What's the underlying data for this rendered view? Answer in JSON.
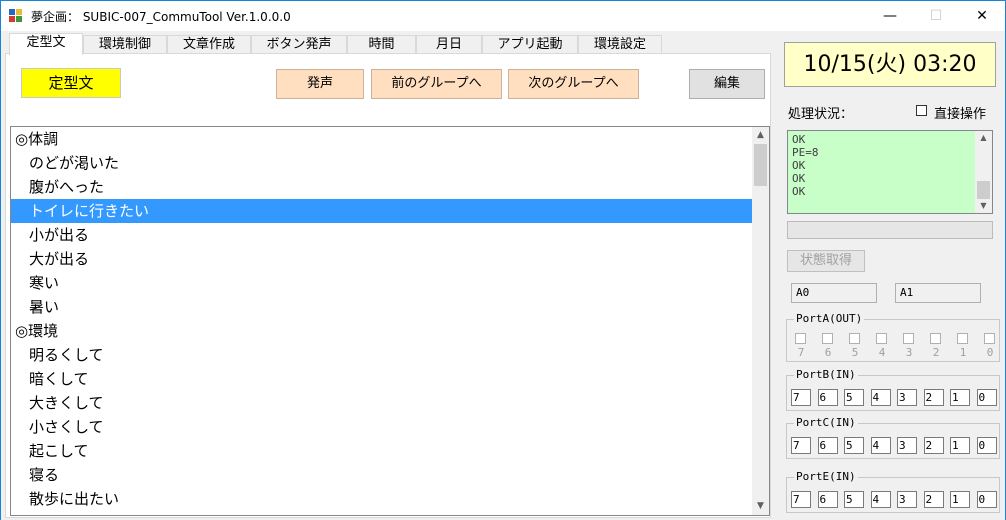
{
  "window": {
    "title": "夢企画： SUBIC-007_CommuTool Ver.1.0.0.0",
    "minimize": "—",
    "maximize": "☐",
    "close": "✕"
  },
  "tabs": [
    {
      "label": "定型文",
      "active": true
    },
    {
      "label": "環境制御",
      "active": false
    },
    {
      "label": "文章作成",
      "active": false
    },
    {
      "label": "ボタン発声",
      "active": false
    },
    {
      "label": "時間",
      "active": false
    },
    {
      "label": "月日",
      "active": false
    },
    {
      "label": "アプリ起動",
      "active": false
    },
    {
      "label": "環境設定",
      "active": false
    }
  ],
  "phrases": {
    "group_label": "定型文",
    "speak_button": "発声",
    "prev_group_button": "前のグループへ",
    "next_group_button": "次のグループへ",
    "edit_button": "編集",
    "items": [
      {
        "text": "◎体調",
        "header": true,
        "selected": false
      },
      {
        "text": "のどが渇いた",
        "header": false,
        "selected": false
      },
      {
        "text": "腹がへった",
        "header": false,
        "selected": false
      },
      {
        "text": "トイレに行きたい",
        "header": false,
        "selected": true
      },
      {
        "text": "小が出る",
        "header": false,
        "selected": false
      },
      {
        "text": "大が出る",
        "header": false,
        "selected": false
      },
      {
        "text": "寒い",
        "header": false,
        "selected": false
      },
      {
        "text": "暑い",
        "header": false,
        "selected": false
      },
      {
        "text": "◎環境",
        "header": true,
        "selected": false
      },
      {
        "text": "明るくして",
        "header": false,
        "selected": false
      },
      {
        "text": "暗くして",
        "header": false,
        "selected": false
      },
      {
        "text": "大きくして",
        "header": false,
        "selected": false
      },
      {
        "text": "小さくして",
        "header": false,
        "selected": false
      },
      {
        "text": "起こして",
        "header": false,
        "selected": false
      },
      {
        "text": "寝る",
        "header": false,
        "selected": false
      },
      {
        "text": "散歩に出たい",
        "header": false,
        "selected": false
      }
    ]
  },
  "status": {
    "clock": "10/15(火) 03:20",
    "processing_label": "処理状況：",
    "direct_operation_label": "直接操作",
    "log": [
      "OK",
      "PE=8",
      "OK",
      "OK",
      "OK"
    ],
    "get_state_button": "状態取得",
    "a0": "A0",
    "a1": "A1"
  },
  "ports": {
    "port_a": {
      "title": "PortA(OUT)",
      "bits": [
        "7",
        "6",
        "5",
        "4",
        "3",
        "2",
        "1",
        "0"
      ]
    },
    "port_b": {
      "title": "PortB(IN)",
      "bits": [
        "7",
        "6",
        "5",
        "4",
        "3",
        "2",
        "1",
        "0"
      ]
    },
    "port_c": {
      "title": "PortC(IN)",
      "bits": [
        "7",
        "6",
        "5",
        "4",
        "3",
        "2",
        "1",
        "0"
      ]
    },
    "port_e": {
      "title": "PortE(IN)",
      "bits": [
        "7",
        "6",
        "5",
        "4",
        "3",
        "2",
        "1",
        "0"
      ]
    }
  },
  "colors": {
    "accent": "#1883d7",
    "selection": "#3399ff",
    "yellow_label": "#ffff00",
    "peach_button": "#ffdfc0",
    "clock_bg": "#ffffc8",
    "log_bg": "#c8ffc8"
  }
}
